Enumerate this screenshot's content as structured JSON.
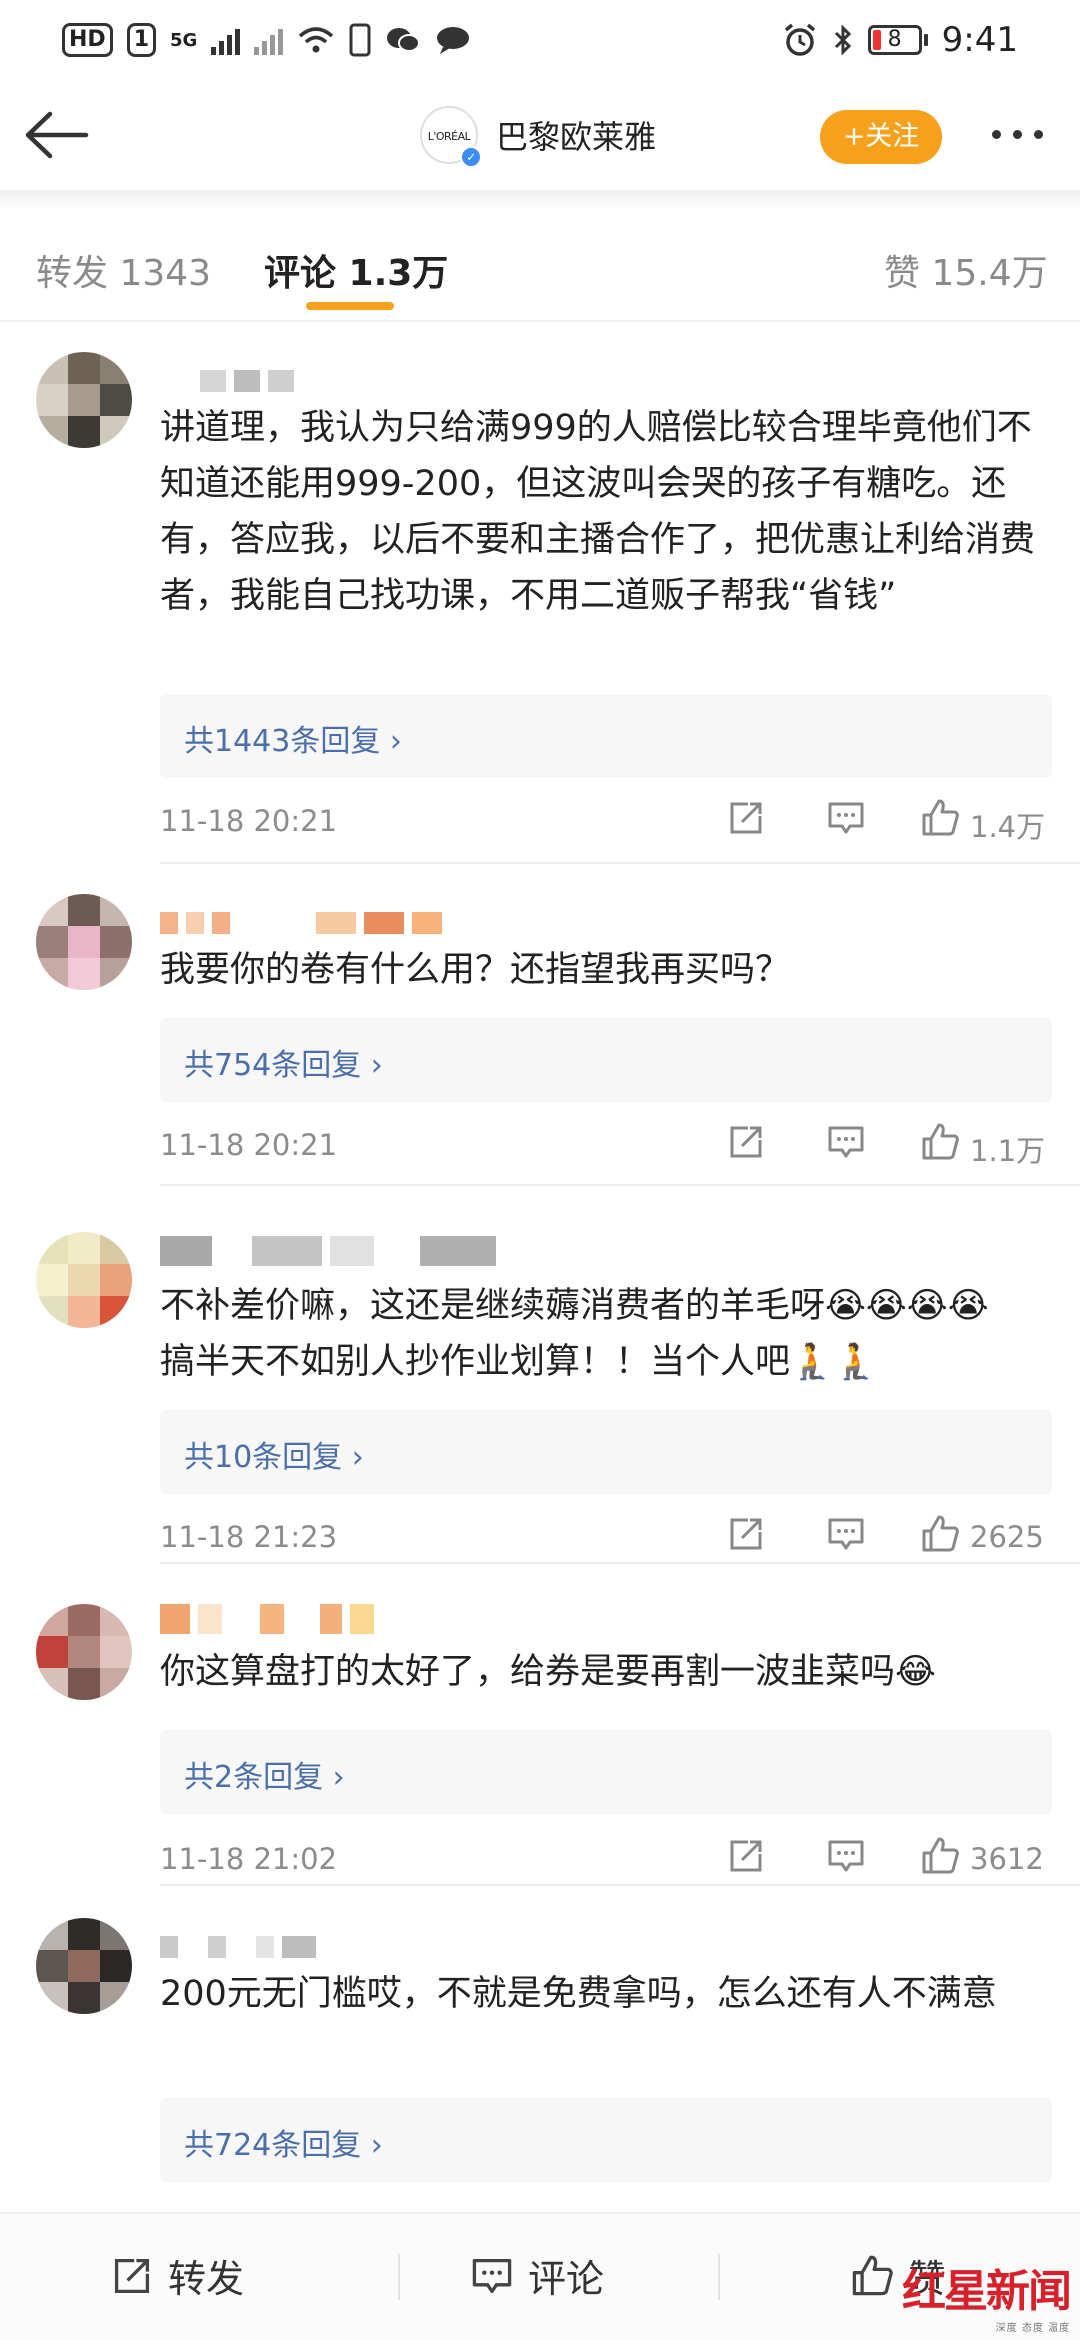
{
  "status_bar": {
    "hd_label": "HD",
    "sim_label": "1",
    "network_label": "5G",
    "battery_level": "8",
    "time": "9:41"
  },
  "header": {
    "logo_text": "L'ORÉAL",
    "account_name": "巴黎欧莱雅",
    "follow_label": "+关注"
  },
  "tabs": [
    {
      "label": "转发 1343",
      "active": false
    },
    {
      "label": "评论 1.3万",
      "active": true
    },
    {
      "label": "赞 15.4万",
      "active": false
    }
  ],
  "comments": [
    {
      "text": "讲道理，我认为只给满999的人赔偿比较合理毕竟他们不知道还能用999-200，但这波叫会哭的孩子有糖吃。还有，答应我，以后不要和主播合作了，把优惠让利给消费者，我能自己找功课，不用二道贩子帮我“省钱”",
      "replies": "共1443条回复 ›",
      "timestamp": "11-18 20:21",
      "likes": "1.4万"
    },
    {
      "text": "我要你的卷有什么用？还指望我再买吗？",
      "replies": "共754条回复 ›",
      "timestamp": "11-18 20:21",
      "likes": "1.1万"
    },
    {
      "text": "不补差价嘛，这还是继续薅消费者的羊毛呀😭😭😭😭",
      "text2": "搞半天不如别人抄作业划算！！当个人吧🧎🧎",
      "replies": "共10条回复 ›",
      "timestamp": "11-18 21:23",
      "likes": "2625"
    },
    {
      "text": "你这算盘打的太好了，给券是要再割一波韭菜吗😂",
      "replies": "共2条回复 ›",
      "timestamp": "11-18 21:02",
      "likes": "3612"
    },
    {
      "text": "200元无门槛哎，不就是免费拿吗，怎么还有人不满意",
      "replies": "共724条回复 ›"
    }
  ],
  "bottom_bar": {
    "repost_label": "转发",
    "comment_label": "评论",
    "like_label": "赞"
  },
  "watermark": {
    "name": "红星新闻",
    "sub": "深度 态度 温度"
  },
  "colors": {
    "accent": "#f7a01c",
    "link": "#4b6fa8",
    "meta": "#8c8c8c"
  }
}
